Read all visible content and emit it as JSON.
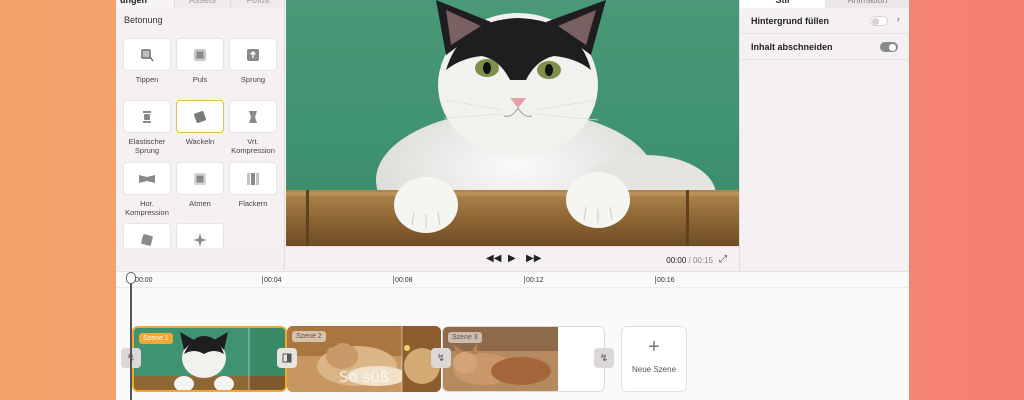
{
  "left_panel": {
    "tabs": [
      {
        "label": "ungen",
        "active": true
      },
      {
        "label": "Assets",
        "active": false
      },
      {
        "label": "Fotos",
        "active": false
      }
    ],
    "section_title": "Betonung",
    "effects": [
      {
        "label": "Tippen",
        "icon": "tap-icon"
      },
      {
        "label": "Puls",
        "icon": "pulse-icon"
      },
      {
        "label": "Sprung",
        "icon": "jump-icon"
      },
      {
        "label": "Elastischer Sprung",
        "icon": "elastic-jump-icon"
      },
      {
        "label": "Wackeln",
        "icon": "wobble-icon",
        "selected": true
      },
      {
        "label": "Vrt. Kompression",
        "icon": "vertical-compress-icon"
      },
      {
        "label": "Hor. Kompression",
        "icon": "horizontal-compress-icon"
      },
      {
        "label": "Atmen",
        "icon": "breathe-icon"
      },
      {
        "label": "Flackern",
        "icon": "flicker-icon"
      },
      {
        "label": "",
        "icon": "rotate-icon"
      },
      {
        "label": "",
        "icon": "sparkle-icon"
      }
    ]
  },
  "transport": {
    "current_time": "00:00",
    "total_time": "/ 00:15"
  },
  "right_panel": {
    "tabs": [
      {
        "label": "Stil",
        "active": true
      },
      {
        "label": "Animation",
        "active": false
      }
    ],
    "rows": [
      {
        "label": "Hintergrund füllen",
        "toggle": false,
        "has_chevron": true
      },
      {
        "label": "Inhalt abschneiden",
        "toggle": true,
        "has_chevron": false
      }
    ]
  },
  "timeline": {
    "ticks": [
      "00:00",
      "00:04",
      "00:08",
      "00:12",
      "00:16"
    ],
    "scenes": [
      {
        "label": "Szene 1",
        "active": true,
        "accent": "#f0a830"
      },
      {
        "label": "Szene 2",
        "active": false,
        "overlay_text": "So süß"
      },
      {
        "label": "Szene 3",
        "active": false
      }
    ],
    "new_scene_label": "Neue Szene"
  },
  "colors": {
    "accent": "#f0a830",
    "preview_bg": "#3f9370"
  }
}
